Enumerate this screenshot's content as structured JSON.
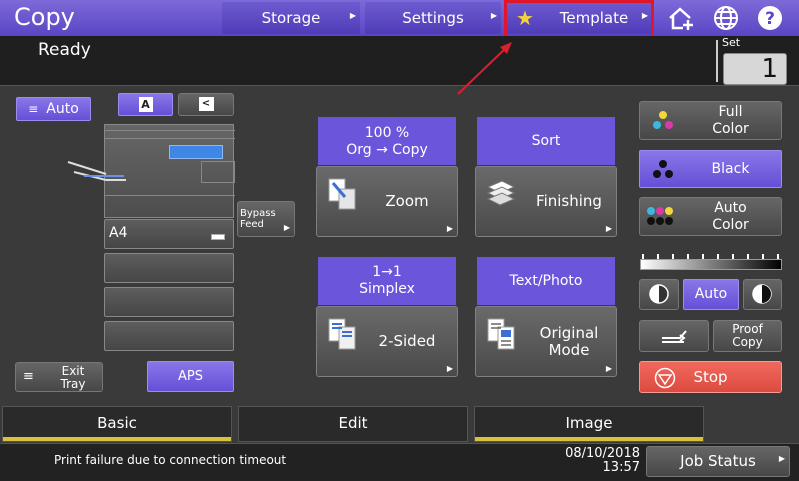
{
  "app": {
    "title": "Copy",
    "status": "Ready"
  },
  "top_buttons": {
    "storage": "Storage",
    "settings": "Settings",
    "template": "Template"
  },
  "set": {
    "label": "Set",
    "value": "1"
  },
  "left": {
    "auto_label": "Auto",
    "orient_a": "A",
    "orient_b": "<",
    "tray_size": "A4",
    "bypass_line1": "Bypass",
    "bypass_line2": "Feed",
    "exit_line1": "Exit",
    "exit_line2": "Tray",
    "aps": "APS"
  },
  "tiles": {
    "zoom_head_line1": "100 %",
    "zoom_head_line2": "Org    →    Copy",
    "zoom": "Zoom",
    "sort_head": "Sort",
    "finishing": "Finishing",
    "simplex_head_line1": "1→1",
    "simplex_head_line2": "Simplex",
    "two_sided": "2-Sided",
    "mode_head": "Text/Photo",
    "original_line1": "Original",
    "original_line2": "Mode"
  },
  "right": {
    "full_line1": "Full",
    "full_line2": "Color",
    "black": "Black",
    "auto_color_line1": "Auto",
    "auto_color_line2": "Color",
    "density_auto": "Auto",
    "proof_line1": "Proof",
    "proof_line2": "Copy",
    "stop": "Stop"
  },
  "tabs": {
    "basic": "Basic",
    "edit": "Edit",
    "image": "Image"
  },
  "footer": {
    "message": "Print failure due to connection timeout",
    "date": "08/10/2018",
    "time": "13:57",
    "job_status": "Job Status"
  },
  "colors": {
    "accent": "#6b55db",
    "highlight": "#e0172a",
    "stop": "#e55a4e",
    "tab_bar": "#d8c23d"
  }
}
